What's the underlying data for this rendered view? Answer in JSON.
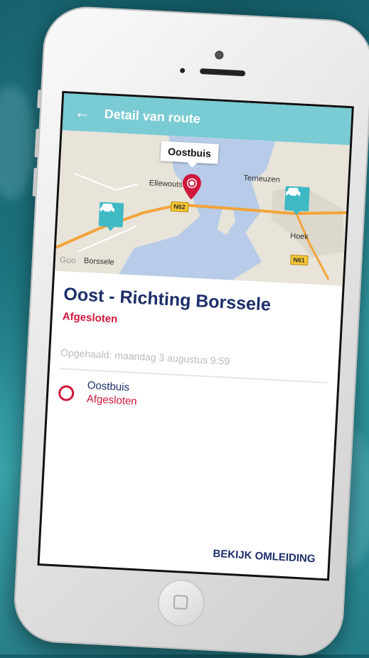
{
  "app": {
    "title": "Detail van route"
  },
  "map": {
    "callout": "Oostbuis",
    "places": {
      "ellewoutsdijk": "Ellewouts",
      "terneuzen": "Terneuzen",
      "hoek": "Hoek",
      "borssele": "Borssele",
      "google": "Goo"
    },
    "roads": {
      "n62": "N62",
      "n61": "N61"
    },
    "colors": {
      "water": "#b8cbe8",
      "land": "#e8e4da",
      "road": "#f2a43a",
      "marker": "#3fb9c4",
      "pin": "#d0173b"
    }
  },
  "route": {
    "title": "Oost - Richting Borssele",
    "status": "Afgesloten",
    "fetched": "Opgehaald: maandag 3 augustus 9:59"
  },
  "tunnel": {
    "name": "Oostbuis",
    "status": "Afgesloten"
  },
  "actions": {
    "detour": "BEKIJK OMLEIDING"
  }
}
